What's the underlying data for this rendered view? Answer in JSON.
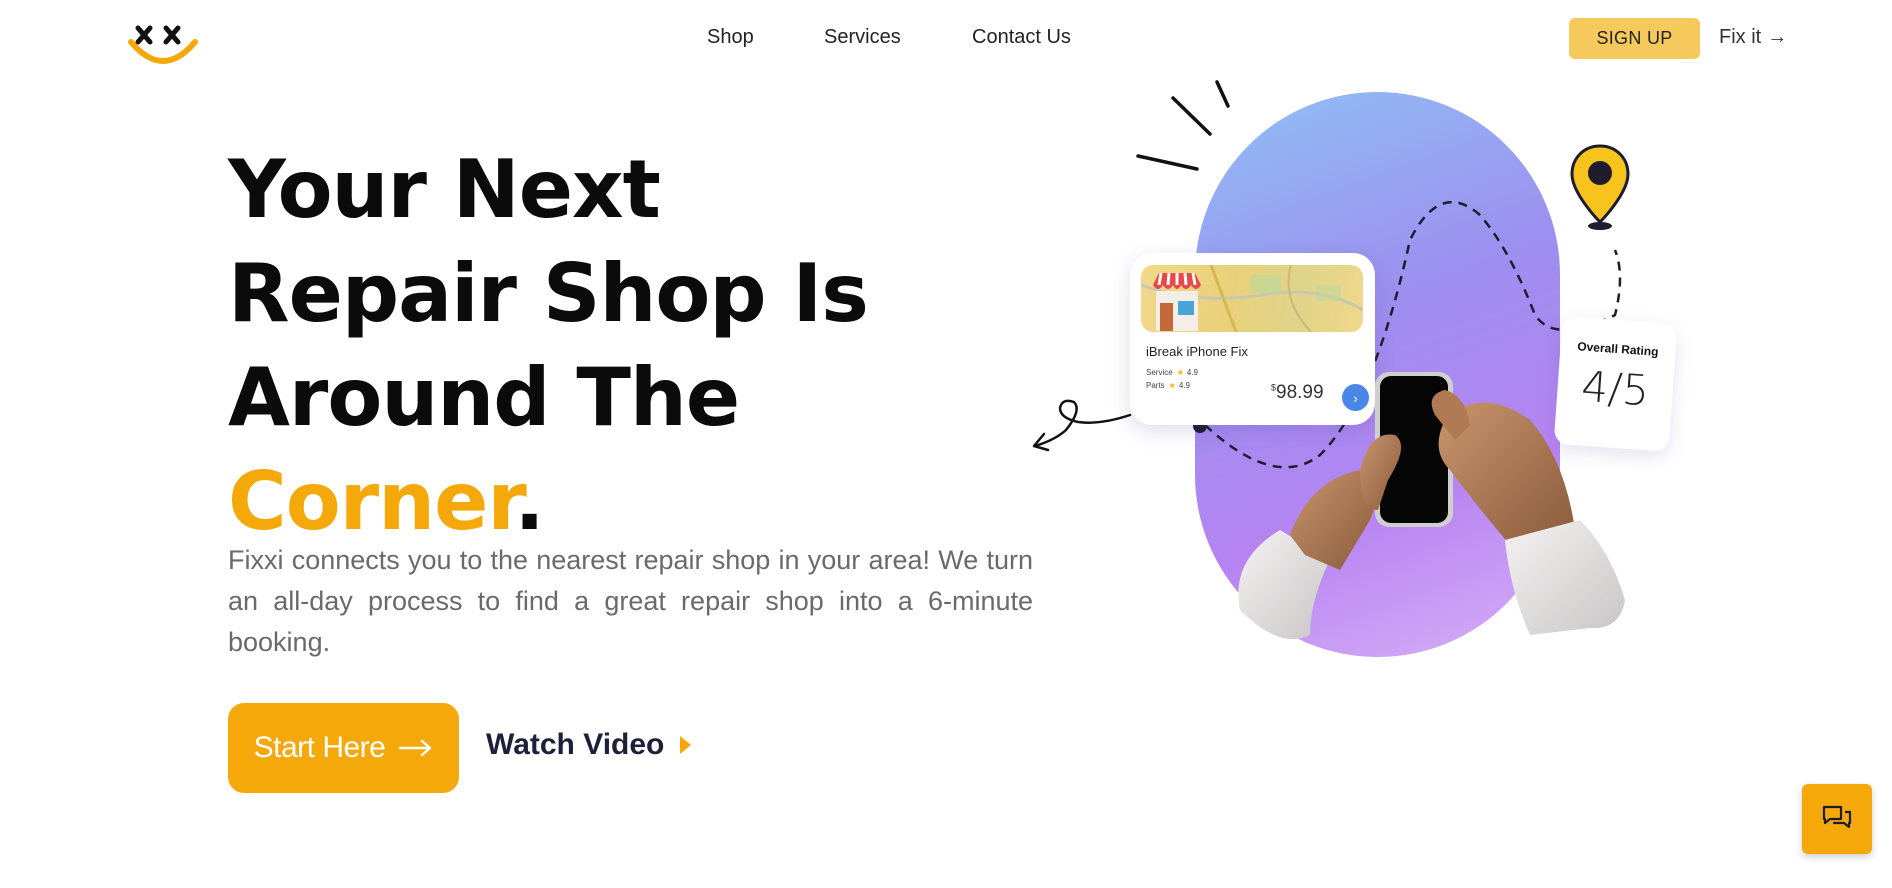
{
  "header": {
    "nav": [
      {
        "label": "Shop"
      },
      {
        "label": "Services"
      },
      {
        "label": "Contact Us"
      }
    ],
    "signup_label": "SIGN UP",
    "fixit_label": "Fix it",
    "fixit_arrow": "→"
  },
  "hero": {
    "headline_line1": "Your Next",
    "headline_line2": "Repair Shop Is",
    "headline_line3": "Around The",
    "headline_accent": "Corner",
    "headline_period": ".",
    "description": "Fixxi connects you to the nearest repair shop in your area! We turn an all-day process to find a great repair shop into a 6-minute booking.",
    "start_label": "Start Here",
    "start_arrow": "→",
    "video_label": "Watch Video"
  },
  "shop_card": {
    "name": "iBreak iPhone Fix",
    "rows": [
      {
        "label": "Service",
        "value": "4.9"
      },
      {
        "label": "Parts",
        "value": "4.9"
      }
    ],
    "currency": "$",
    "price": "98.99",
    "go_icon": "›"
  },
  "rating_card": {
    "label": "Overall Rating",
    "value": "4/5"
  },
  "icons": {
    "logo": "fixxi-logo",
    "chat": "chat-icon",
    "pin": "location-pin-icon"
  },
  "colors": {
    "accent": "#f5a80a",
    "signup_bg": "#f5c95c",
    "text_dark": "#0b0b0b",
    "video_text": "#1e1f3b"
  }
}
